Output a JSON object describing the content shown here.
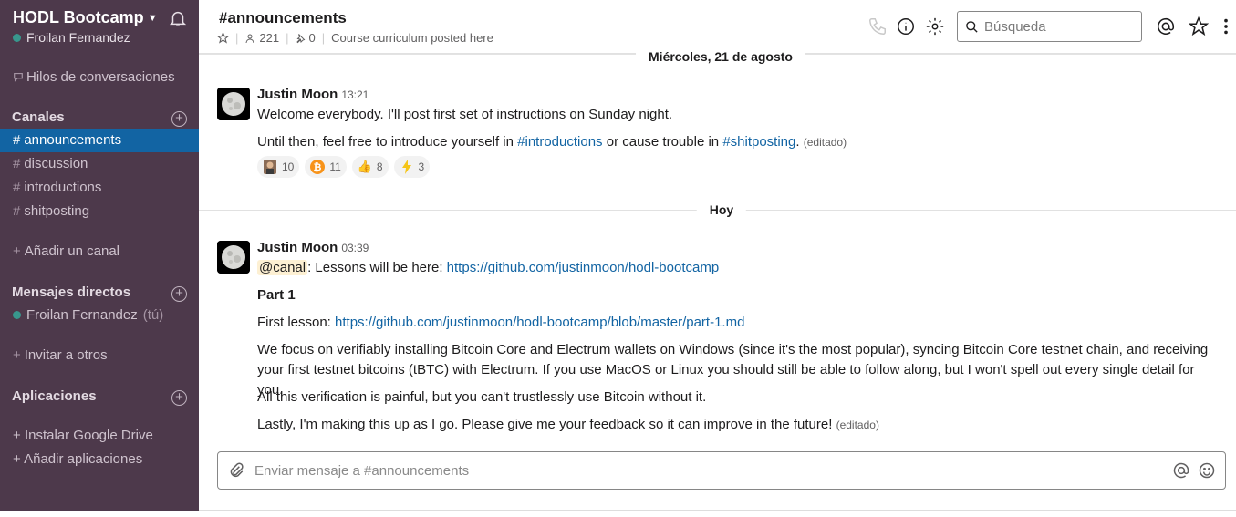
{
  "workspace": {
    "name": "HODL Bootcamp",
    "user": "Froilan Fernandez"
  },
  "sidebar": {
    "threads_label": "Hilos de conversaciones",
    "channels_header": "Canales",
    "channels": [
      "announcements",
      "discussion",
      "introductions",
      "shitposting"
    ],
    "add_channel": "Añadir un canal",
    "dm_header": "Mensajes directos",
    "dm_user": "Froilan Fernandez",
    "dm_you": "(tú)",
    "invite": "Invitar a otros",
    "apps_header": "Aplicaciones",
    "install_drive": "Instalar Google Drive",
    "add_apps": "Añadir aplicaciones"
  },
  "channel": {
    "title": "#announcements",
    "members": "221",
    "pins": "0",
    "topic": "Course curriculum posted here"
  },
  "search": {
    "placeholder": "Búsqueda"
  },
  "messages": {
    "divider1": "Miércoles, 21 de agosto",
    "divider2": "Hoy",
    "m1": {
      "author": "Justin Moon",
      "time": "13:21",
      "line1": "Welcome everybody. I'll post first set of instructions on Sunday night.",
      "line2_a": "Until then, feel free to introduce yourself in ",
      "line2_link1": "#introductions",
      "line2_b": " or cause trouble in ",
      "line2_link2": "#shitposting",
      "line2_c": ".",
      "edited": "(editado)",
      "reactions": [
        "10",
        "11",
        "8",
        "3"
      ]
    },
    "m2": {
      "author": "Justin Moon",
      "time": "03:39",
      "mention": "@canal",
      "line1": ": Lessons will be here: ",
      "link1": "https://github.com/justinmoon/hodl-bootcamp",
      "part": "Part 1",
      "lesson_label": "First lesson: ",
      "link2": "https://github.com/justinmoon/hodl-bootcamp/blob/master/part-1.md",
      "para1": "We focus on verifiably installing Bitcoin Core and Electrum wallets on Windows (since it's the most popular), syncing Bitcoin Core testnet chain, and receiving your first testnet bitcoins (tBTC) with Electrum. If you use MacOS or Linux you should still be able to follow along, but I won't spell out every single detail for you.",
      "para2": "All this verification is painful, but you can't trustlessly use Bitcoin without it.",
      "para3": "Lastly, I'm making this up as I go. Please give me your feedback so it can improve in the future!",
      "edited": "(editado)"
    }
  },
  "composer": {
    "placeholder": "Enviar mensaje a #announcements"
  }
}
